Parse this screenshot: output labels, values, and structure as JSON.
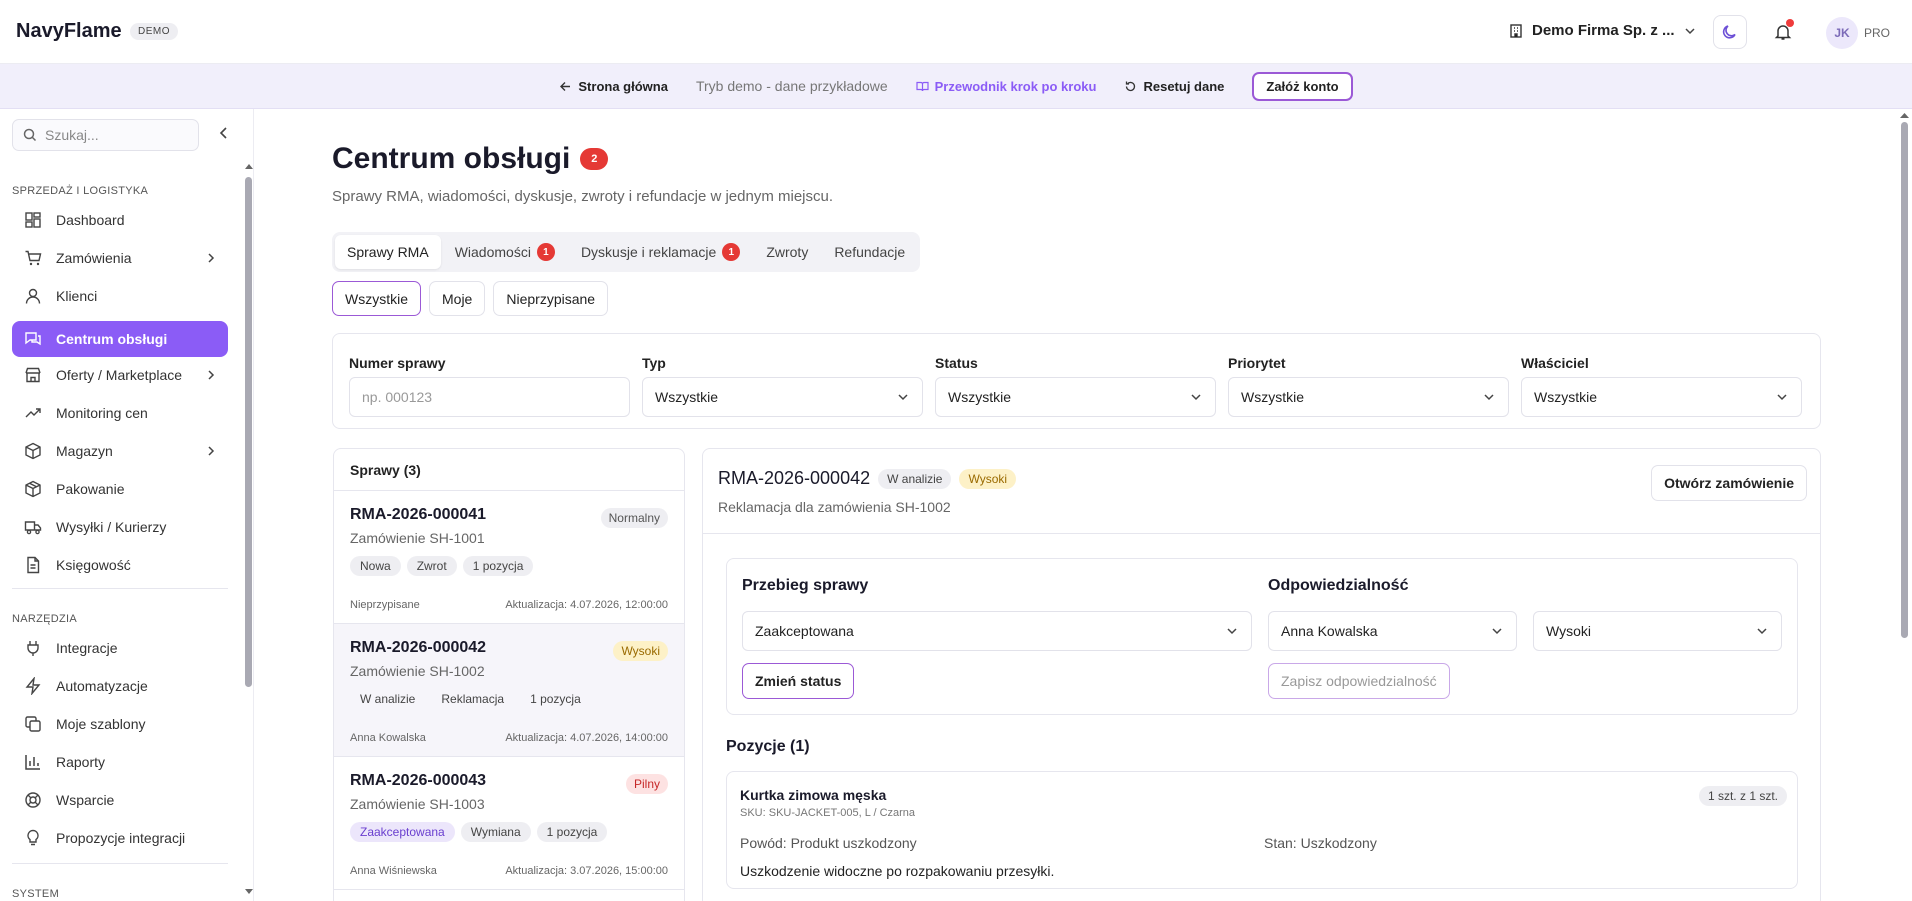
{
  "header": {
    "brand": "NavyFlame",
    "demo_badge": "DEMO",
    "company": "Demo Firma Sp. z ...",
    "avatar_initials": "JK",
    "plan": "PRO"
  },
  "demobar": {
    "home": "Strona główna",
    "mode": "Tryb demo - dane przykładowe",
    "guide": "Przewodnik krok po kroku",
    "reset": "Resetuj dane",
    "signup": "Załóż konto"
  },
  "sidebar": {
    "search_placeholder": "Szukaj...",
    "section_sales": "SPRZEDAŻ I LOGISTYKA",
    "items_sales": [
      {
        "label": "Dashboard",
        "icon": "dashboard-icon"
      },
      {
        "label": "Zamówienia",
        "icon": "cart-icon"
      },
      {
        "label": "Klienci",
        "icon": "user-icon"
      },
      {
        "label": "Centrum obsługi",
        "icon": "chat-icon"
      },
      {
        "label": "Oferty / Marketplace",
        "icon": "store-icon"
      },
      {
        "label": "Monitoring cen",
        "icon": "trend-icon"
      },
      {
        "label": "Magazyn",
        "icon": "box-icon"
      },
      {
        "label": "Pakowanie",
        "icon": "package-icon"
      },
      {
        "label": "Wysyłki / Kurierzy",
        "icon": "truck-icon"
      },
      {
        "label": "Księgowość",
        "icon": "document-icon"
      }
    ],
    "section_tools": "NARZĘDZIA",
    "items_tools": [
      {
        "label": "Integracje",
        "icon": "plug-icon"
      },
      {
        "label": "Automatyzacje",
        "icon": "bolt-icon"
      },
      {
        "label": "Moje szablony",
        "icon": "copy-icon"
      },
      {
        "label": "Raporty",
        "icon": "bar-chart-icon"
      },
      {
        "label": "Wsparcie",
        "icon": "lifebuoy-icon"
      },
      {
        "label": "Propozycje integracji",
        "icon": "lightbulb-icon"
      }
    ],
    "section_system": "SYSTEM"
  },
  "page": {
    "title": "Centrum obsługi",
    "title_count": "2",
    "subtitle": "Sprawy RMA, wiadomości, dyskusje, zwroty i refundacje w jednym miejscu."
  },
  "tabs": [
    {
      "label": "Sprawy RMA",
      "count": ""
    },
    {
      "label": "Wiadomości",
      "count": "1"
    },
    {
      "label": "Dyskusje i reklamacje",
      "count": "1"
    },
    {
      "label": "Zwroty",
      "count": ""
    },
    {
      "label": "Refundacje",
      "count": ""
    }
  ],
  "subtabs": [
    "Wszystkie",
    "Moje",
    "Nieprzypisane"
  ],
  "filters": {
    "case_number_label": "Numer sprawy",
    "case_number_placeholder": "np. 000123",
    "type_label": "Typ",
    "type_value": "Wszystkie",
    "status_label": "Status",
    "status_value": "Wszystkie",
    "priority_label": "Priorytet",
    "priority_value": "Wszystkie",
    "owner_label": "Właściciel",
    "owner_value": "Wszystkie"
  },
  "cases": {
    "heading": "Sprawy (3)",
    "items": [
      {
        "id": "RMA-2026-000041",
        "order": "Zamówienie SH-1001",
        "priority": "Normalny",
        "chips": [
          "Nowa",
          "Zwrot",
          "1 pozycja"
        ],
        "owner": "Nieprzypisane",
        "updated": "Aktualizacja: 4.07.2026, 12:00:00"
      },
      {
        "id": "RMA-2026-000042",
        "order": "Zamówienie SH-1002",
        "priority": "Wysoki",
        "chips": [
          "W analizie",
          "Reklamacja",
          "1 pozycja"
        ],
        "owner": "Anna Kowalska",
        "updated": "Aktualizacja: 4.07.2026, 14:00:00"
      },
      {
        "id": "RMA-2026-000043",
        "order": "Zamówienie SH-1003",
        "priority": "Pilny",
        "chips": [
          "Zaakceptowana",
          "Wymiana",
          "1 pozycja"
        ],
        "owner": "Anna Wiśniewska",
        "updated": "Aktualizacja: 3.07.2026, 15:00:00"
      }
    ]
  },
  "detail": {
    "id": "RMA-2026-000042",
    "status": "W analizie",
    "priority": "Wysoki",
    "subtitle": "Reklamacja dla zamówienia SH-1002",
    "open_order": "Otwórz zamówienie",
    "flow_title": "Przebieg sprawy",
    "flow_status_value": "Zaakceptowana",
    "change_status": "Zmień status",
    "responsibility_title": "Odpowiedzialność",
    "owner_value": "Anna Kowalska",
    "priority_value": "Wysoki",
    "save_responsibility": "Zapisz odpowiedzialność",
    "positions_title": "Pozycje (1)",
    "position": {
      "name": "Kurtka zimowa męska",
      "sku": "SKU: SKU-JACKET-005, L / Czarna",
      "qty": "1 szt. z 1 szt.",
      "reason": "Powód: Produkt uszkodzony",
      "state": "Stan: Uszkodzony",
      "note": "Uszkodzenie widoczne po rozpakowaniu przesyłki."
    }
  },
  "colors": {
    "accent": "#8b5cf6",
    "badge_red": "#e53935",
    "high_bg": "#fdf1c7",
    "urgent_bg": "#fde2e2"
  }
}
